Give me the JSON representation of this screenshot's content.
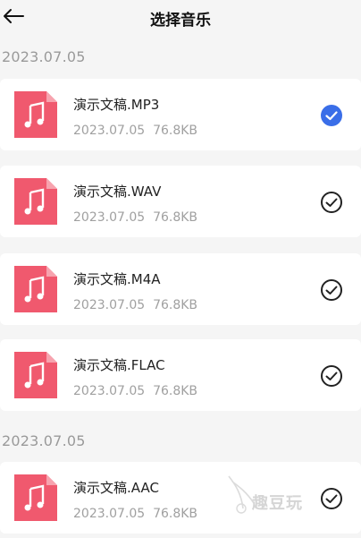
{
  "header": {
    "title": "选择音乐"
  },
  "groups": [
    {
      "date": "2023.07.05",
      "items": [
        {
          "name": "演示文稿.MP3",
          "date": "2023.07.05",
          "size": "76.8KB",
          "selected": true
        },
        {
          "name": "演示文稿.WAV",
          "date": "2023.07.05",
          "size": "76.8KB",
          "selected": false
        },
        {
          "name": "演示文稿.M4A",
          "date": "2023.07.05",
          "size": "76.8KB",
          "selected": false
        },
        {
          "name": "演示文稿.FLAC",
          "date": "2023.07.05",
          "size": "76.8KB",
          "selected": false
        }
      ]
    },
    {
      "date": "2023.07.05",
      "items": [
        {
          "name": "演示文稿.AAC",
          "date": "2023.07.05",
          "size": "76.8KB",
          "selected": false
        }
      ]
    }
  ],
  "watermark": "趣豆玩",
  "colors": {
    "accent": "#3a6ee8",
    "file_icon": "#f0596e",
    "file_fold": "#f7a3ae",
    "check_unselected": "#222222"
  },
  "icons": {
    "back": "arrow-left-icon",
    "file": "music-file-icon",
    "selected": "check-circle-filled-icon",
    "unselected": "check-circle-outline-icon"
  }
}
